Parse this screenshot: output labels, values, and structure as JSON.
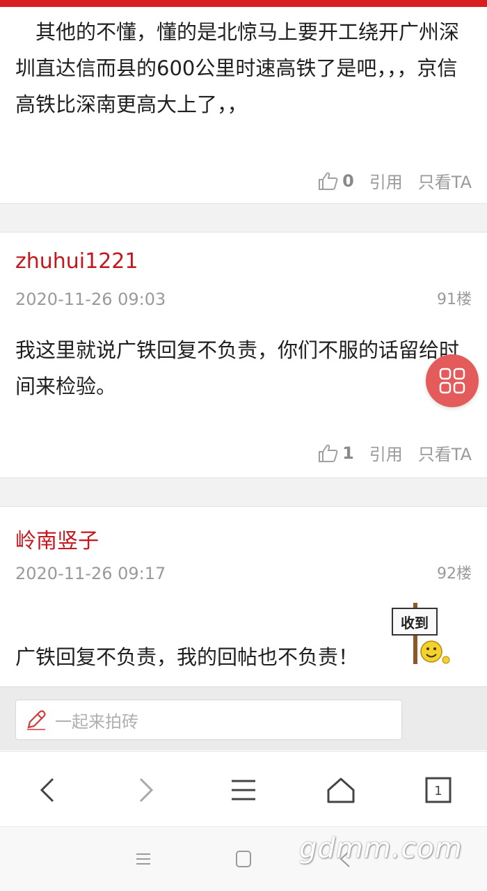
{
  "posts": [
    {
      "body": "　其他的不懂，懂的是北惊马上要开工绕开广州深圳直达信而县的600公里时速高铁了是吧，，，京信高铁比深南更高大上了，，",
      "likes": "0",
      "quote_label": "引用",
      "only_ta_label": "只看TA"
    },
    {
      "author": "zhuhui1221",
      "time": "2020-11-26 09:03",
      "floor": "91楼",
      "body": "我这里就说广铁回复不负责，你们不服的话留给时间来检验。",
      "likes": "1",
      "quote_label": "引用",
      "only_ta_label": "只看TA"
    },
    {
      "author": "岭南竖子",
      "time": "2020-11-26 09:17",
      "floor": "92楼",
      "body": "广铁回复不负责，我的回帖也不负责！",
      "emoji_sign_text": "收到"
    }
  ],
  "reply_bar": {
    "placeholder": "一起来拍砖"
  },
  "browser_nav": {
    "tab_count": "1"
  },
  "watermark": "gdmm.com",
  "colors": {
    "accent": "#d71f1f",
    "author": "#c4161c",
    "fab": "#e35b5b"
  },
  "icons": [
    "like-icon",
    "grid-menu-icon",
    "pen-icon",
    "back-arrow-icon",
    "forward-arrow-icon",
    "menu-icon",
    "home-icon",
    "tabs-icon"
  ]
}
